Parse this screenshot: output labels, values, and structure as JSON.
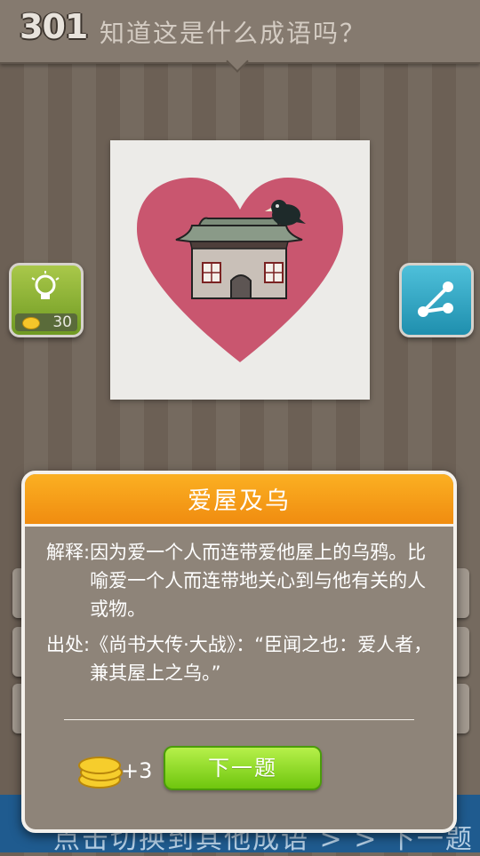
{
  "header": {
    "level": "301",
    "question": "知道这是什么成语吗？"
  },
  "hint": {
    "cost": "30"
  },
  "colors": {
    "accent_orange": "#f39a14",
    "button_green": "#8fdc22",
    "hint_green": "#8cb23a",
    "share_blue": "#2fa8c8"
  },
  "icons": [
    "lightbulb-icon",
    "share-icon",
    "coin-icon"
  ],
  "bottom": {
    "text": "点击切换到其他成语 > > 下一题"
  },
  "dialog": {
    "title": "爱屋及乌",
    "definition_label": "解释:",
    "definition_text": "因为爱一个人而连带爱他屋上的乌鸦。比喻爱一个人而连带地关心到与他有关的人或物。",
    "source_label": "出处:",
    "source_text": "《尚书大传·大战》：“臣闻之也：爱人者，兼其屋上之乌。”",
    "reward": "+3",
    "next_label": "下一题"
  }
}
